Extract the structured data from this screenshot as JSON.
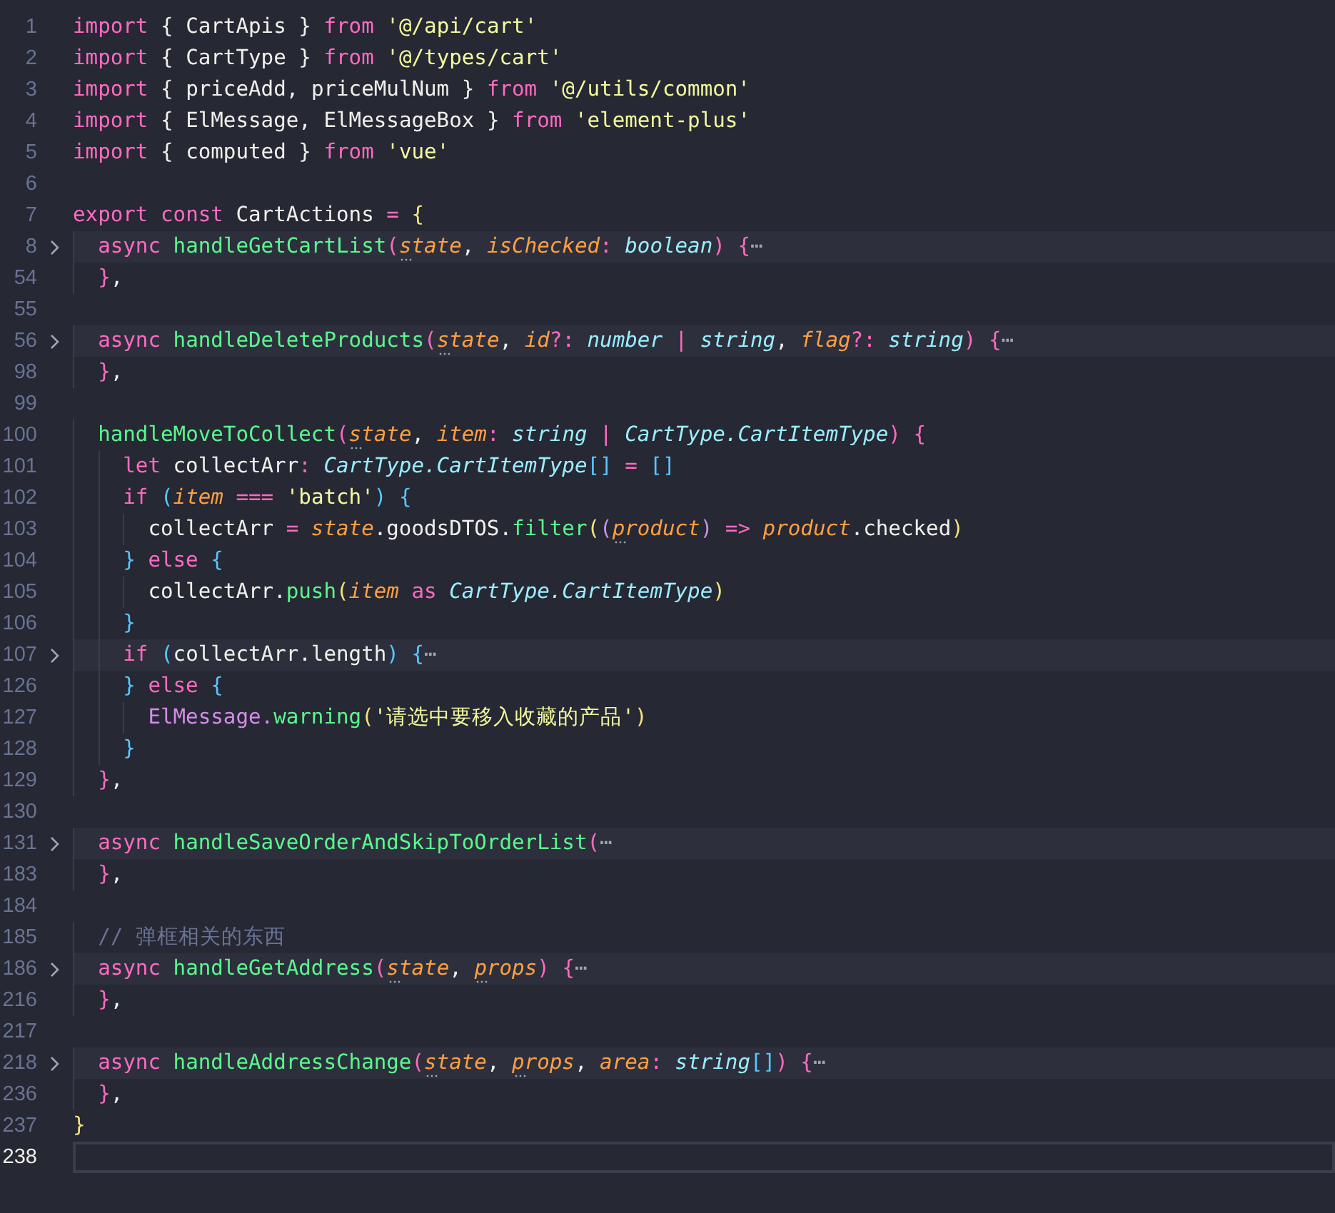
{
  "editor": {
    "lines": [
      {
        "number": "1",
        "folded": false,
        "current": false,
        "tokens": [
          {
            "kind": "kw",
            "text": "import"
          },
          {
            "kind": "var",
            "text": " { CartApis } "
          },
          {
            "kind": "kw",
            "text": "from "
          },
          {
            "kind": "str",
            "text": "'@/api/cart'"
          }
        ]
      },
      {
        "number": "2",
        "folded": false,
        "current": false,
        "tokens": [
          {
            "kind": "kw",
            "text": "import"
          },
          {
            "kind": "var",
            "text": " { CartType } "
          },
          {
            "kind": "kw",
            "text": "from "
          },
          {
            "kind": "str",
            "text": "'@/types/cart'"
          }
        ]
      },
      {
        "number": "3",
        "folded": false,
        "current": false,
        "tokens": [
          {
            "kind": "kw",
            "text": "import"
          },
          {
            "kind": "var",
            "text": " { priceAdd, priceMulNum } "
          },
          {
            "kind": "kw",
            "text": "from "
          },
          {
            "kind": "str",
            "text": "'@/utils/common'"
          }
        ]
      },
      {
        "number": "4",
        "folded": false,
        "current": false,
        "tokens": [
          {
            "kind": "kw",
            "text": "import"
          },
          {
            "kind": "var",
            "text": " { ElMessage, ElMessageBox } "
          },
          {
            "kind": "kw",
            "text": "from "
          },
          {
            "kind": "str",
            "text": "'element-plus'"
          }
        ]
      },
      {
        "number": "5",
        "folded": false,
        "current": false,
        "tokens": [
          {
            "kind": "kw",
            "text": "import"
          },
          {
            "kind": "var",
            "text": " { computed } "
          },
          {
            "kind": "kw",
            "text": "from "
          },
          {
            "kind": "str",
            "text": "'vue'"
          }
        ]
      },
      {
        "number": "6",
        "folded": false,
        "current": false
      },
      {
        "number": "7",
        "folded": false,
        "current": false,
        "tokens": [
          {
            "kind": "kw",
            "text": "export const"
          },
          {
            "kind": "var",
            "text": " CartActions "
          },
          {
            "kind": "op",
            "text": "= "
          },
          {
            "kind": "b1",
            "text": "{"
          }
        ]
      },
      {
        "number": "8",
        "folded": true,
        "current": false,
        "tokens": [
          {
            "kind": "kw",
            "text": "  async "
          },
          {
            "kind": "fn",
            "text": "handleGetCartList"
          },
          {
            "kind": "b2",
            "text": "("
          },
          {
            "kind": "unused",
            "text": "state"
          },
          {
            "kind": "var",
            "text": ", "
          },
          {
            "kind": "param",
            "text": "isChecked"
          },
          {
            "kind": "op",
            "text": ": "
          },
          {
            "kind": "type",
            "text": "boolean"
          },
          {
            "kind": "b2",
            "text": ") {"
          },
          {
            "kind": "dim",
            "text": "⋯"
          }
        ]
      },
      {
        "number": "54",
        "folded": false,
        "current": false,
        "tokens": [
          {
            "kind": "b2",
            "text": "  }"
          },
          {
            "kind": "var",
            "text": ","
          }
        ]
      },
      {
        "number": "55",
        "folded": false,
        "current": false
      },
      {
        "number": "56",
        "folded": true,
        "current": false,
        "tokens": [
          {
            "kind": "kw",
            "text": "  async "
          },
          {
            "kind": "fn",
            "text": "handleDeleteProducts"
          },
          {
            "kind": "b2",
            "text": "("
          },
          {
            "kind": "unused",
            "text": "state"
          },
          {
            "kind": "var",
            "text": ", "
          },
          {
            "kind": "param",
            "text": "id"
          },
          {
            "kind": "op",
            "text": "?: "
          },
          {
            "kind": "type",
            "text": "number"
          },
          {
            "kind": "op",
            "text": " | "
          },
          {
            "kind": "type",
            "text": "string"
          },
          {
            "kind": "var",
            "text": ", "
          },
          {
            "kind": "param",
            "text": "flag"
          },
          {
            "kind": "op",
            "text": "?: "
          },
          {
            "kind": "type",
            "text": "string"
          },
          {
            "kind": "b2",
            "text": ") {"
          },
          {
            "kind": "dim",
            "text": "⋯"
          }
        ]
      },
      {
        "number": "98",
        "folded": false,
        "current": false,
        "tokens": [
          {
            "kind": "b2",
            "text": "  }"
          },
          {
            "kind": "var",
            "text": ","
          }
        ]
      },
      {
        "number": "99",
        "folded": false,
        "current": false
      },
      {
        "number": "100",
        "folded": false,
        "current": false,
        "tokens": [
          {
            "kind": "fn",
            "text": "  handleMoveToCollect"
          },
          {
            "kind": "b2",
            "text": "("
          },
          {
            "kind": "unused",
            "text": "state"
          },
          {
            "kind": "var",
            "text": ", "
          },
          {
            "kind": "param",
            "text": "item"
          },
          {
            "kind": "op",
            "text": ": "
          },
          {
            "kind": "type",
            "text": "string"
          },
          {
            "kind": "op",
            "text": " | "
          },
          {
            "kind": "type",
            "text": "CartType.CartItemType"
          },
          {
            "kind": "b2",
            "text": ") {"
          }
        ]
      },
      {
        "number": "101",
        "folded": false,
        "current": false,
        "tokens": [
          {
            "kind": "kw",
            "text": "    let"
          },
          {
            "kind": "var",
            "text": " collectArr"
          },
          {
            "kind": "op",
            "text": ": "
          },
          {
            "kind": "type",
            "text": "CartType.CartItemType"
          },
          {
            "kind": "b3",
            "text": "[]"
          },
          {
            "kind": "op",
            "text": " = "
          },
          {
            "kind": "b3",
            "text": "[]"
          }
        ]
      },
      {
        "number": "102",
        "folded": false,
        "current": false,
        "tokens": [
          {
            "kind": "kw",
            "text": "    if "
          },
          {
            "kind": "b3",
            "text": "("
          },
          {
            "kind": "param",
            "text": "item"
          },
          {
            "kind": "op",
            "text": " === "
          },
          {
            "kind": "str",
            "text": "'batch'"
          },
          {
            "kind": "b3",
            "text": ") {"
          }
        ]
      },
      {
        "number": "103",
        "folded": false,
        "current": false,
        "tokens": [
          {
            "kind": "var",
            "text": "      collectArr "
          },
          {
            "kind": "op",
            "text": "= "
          },
          {
            "kind": "param",
            "text": "state"
          },
          {
            "kind": "var",
            "text": ".goodsDTOS."
          },
          {
            "kind": "fn",
            "text": "filter"
          },
          {
            "kind": "b1",
            "text": "("
          },
          {
            "kind": "b4",
            "text": "("
          },
          {
            "kind": "unused",
            "text": "product"
          },
          {
            "kind": "b4",
            "text": ")"
          },
          {
            "kind": "op",
            "text": " => "
          },
          {
            "kind": "param",
            "text": "product"
          },
          {
            "kind": "var",
            "text": ".checked"
          },
          {
            "kind": "b1",
            "text": ")"
          }
        ]
      },
      {
        "number": "104",
        "folded": false,
        "current": false,
        "tokens": [
          {
            "kind": "b3",
            "text": "    } "
          },
          {
            "kind": "kw",
            "text": "else "
          },
          {
            "kind": "b3",
            "text": "{"
          }
        ]
      },
      {
        "number": "105",
        "folded": false,
        "current": false,
        "tokens": [
          {
            "kind": "var",
            "text": "      collectArr."
          },
          {
            "kind": "fn",
            "text": "push"
          },
          {
            "kind": "b1",
            "text": "("
          },
          {
            "kind": "param",
            "text": "item"
          },
          {
            "kind": "kw",
            "text": " as "
          },
          {
            "kind": "type",
            "text": "CartType.CartItemType"
          },
          {
            "kind": "b1",
            "text": ")"
          }
        ]
      },
      {
        "number": "106",
        "folded": false,
        "current": false,
        "tokens": [
          {
            "kind": "b3",
            "text": "    }"
          }
        ]
      },
      {
        "number": "107",
        "folded": true,
        "current": false,
        "tokens": [
          {
            "kind": "kw",
            "text": "    if "
          },
          {
            "kind": "b3",
            "text": "("
          },
          {
            "kind": "var",
            "text": "collectArr.length"
          },
          {
            "kind": "b3",
            "text": ") {"
          },
          {
            "kind": "dim",
            "text": "⋯"
          }
        ]
      },
      {
        "number": "126",
        "folded": false,
        "current": false,
        "tokens": [
          {
            "kind": "b3",
            "text": "    } "
          },
          {
            "kind": "kw",
            "text": "else "
          },
          {
            "kind": "b3",
            "text": "{"
          }
        ]
      },
      {
        "number": "127",
        "folded": false,
        "current": false,
        "tokens": [
          {
            "kind": "cls",
            "text": "      ElMessage."
          },
          {
            "kind": "fn",
            "text": "warning"
          },
          {
            "kind": "b1",
            "text": "("
          },
          {
            "kind": "str",
            "text": "'请选中要移入收藏的产品'"
          },
          {
            "kind": "b1",
            "text": ")"
          }
        ]
      },
      {
        "number": "128",
        "folded": false,
        "current": false,
        "tokens": [
          {
            "kind": "b3",
            "text": "    }"
          }
        ]
      },
      {
        "number": "129",
        "folded": false,
        "current": false,
        "tokens": [
          {
            "kind": "b2",
            "text": "  }"
          },
          {
            "kind": "var",
            "text": ","
          }
        ]
      },
      {
        "number": "130",
        "folded": false,
        "current": false
      },
      {
        "number": "131",
        "folded": true,
        "current": false,
        "tokens": [
          {
            "kind": "kw",
            "text": "  async "
          },
          {
            "kind": "fn",
            "text": "handleSaveOrderAndSkipToOrderList"
          },
          {
            "kind": "b2",
            "text": "("
          },
          {
            "kind": "dim",
            "text": "⋯"
          }
        ]
      },
      {
        "number": "183",
        "folded": false,
        "current": false,
        "tokens": [
          {
            "kind": "b2",
            "text": "  }"
          },
          {
            "kind": "var",
            "text": ","
          }
        ]
      },
      {
        "number": "184",
        "folded": false,
        "current": false
      },
      {
        "number": "185",
        "folded": false,
        "current": false,
        "tokens": [
          {
            "kind": "comment",
            "text": "  // 弹框相关的东西"
          }
        ]
      },
      {
        "number": "186",
        "folded": true,
        "current": false,
        "tokens": [
          {
            "kind": "kw",
            "text": "  async "
          },
          {
            "kind": "fn",
            "text": "handleGetAddress"
          },
          {
            "kind": "b2",
            "text": "("
          },
          {
            "kind": "unused",
            "text": "state"
          },
          {
            "kind": "var",
            "text": ", "
          },
          {
            "kind": "unused",
            "text": "props"
          },
          {
            "kind": "b2",
            "text": ") {"
          },
          {
            "kind": "dim",
            "text": "⋯"
          }
        ]
      },
      {
        "number": "216",
        "folded": false,
        "current": false,
        "tokens": [
          {
            "kind": "b2",
            "text": "  }"
          },
          {
            "kind": "var",
            "text": ","
          }
        ]
      },
      {
        "number": "217",
        "folded": false,
        "current": false
      },
      {
        "number": "218",
        "folded": true,
        "current": false,
        "tokens": [
          {
            "kind": "kw",
            "text": "  async "
          },
          {
            "kind": "fn",
            "text": "handleAddressChange"
          },
          {
            "kind": "b2",
            "text": "("
          },
          {
            "kind": "unused",
            "text": "state"
          },
          {
            "kind": "var",
            "text": ", "
          },
          {
            "kind": "unused",
            "text": "props"
          },
          {
            "kind": "var",
            "text": ", "
          },
          {
            "kind": "param",
            "text": "area"
          },
          {
            "kind": "op",
            "text": ": "
          },
          {
            "kind": "type",
            "text": "string"
          },
          {
            "kind": "b3",
            "text": "[]"
          },
          {
            "kind": "b2",
            "text": ") {"
          },
          {
            "kind": "dim",
            "text": "⋯"
          }
        ]
      },
      {
        "number": "236",
        "folded": false,
        "current": false,
        "tokens": [
          {
            "kind": "b2",
            "text": "  }"
          },
          {
            "kind": "var",
            "text": ","
          }
        ]
      },
      {
        "number": "237",
        "folded": false,
        "current": false,
        "tokens": [
          {
            "kind": "b1",
            "text": "}"
          }
        ]
      },
      {
        "number": "238",
        "folded": false,
        "current": true
      }
    ]
  }
}
